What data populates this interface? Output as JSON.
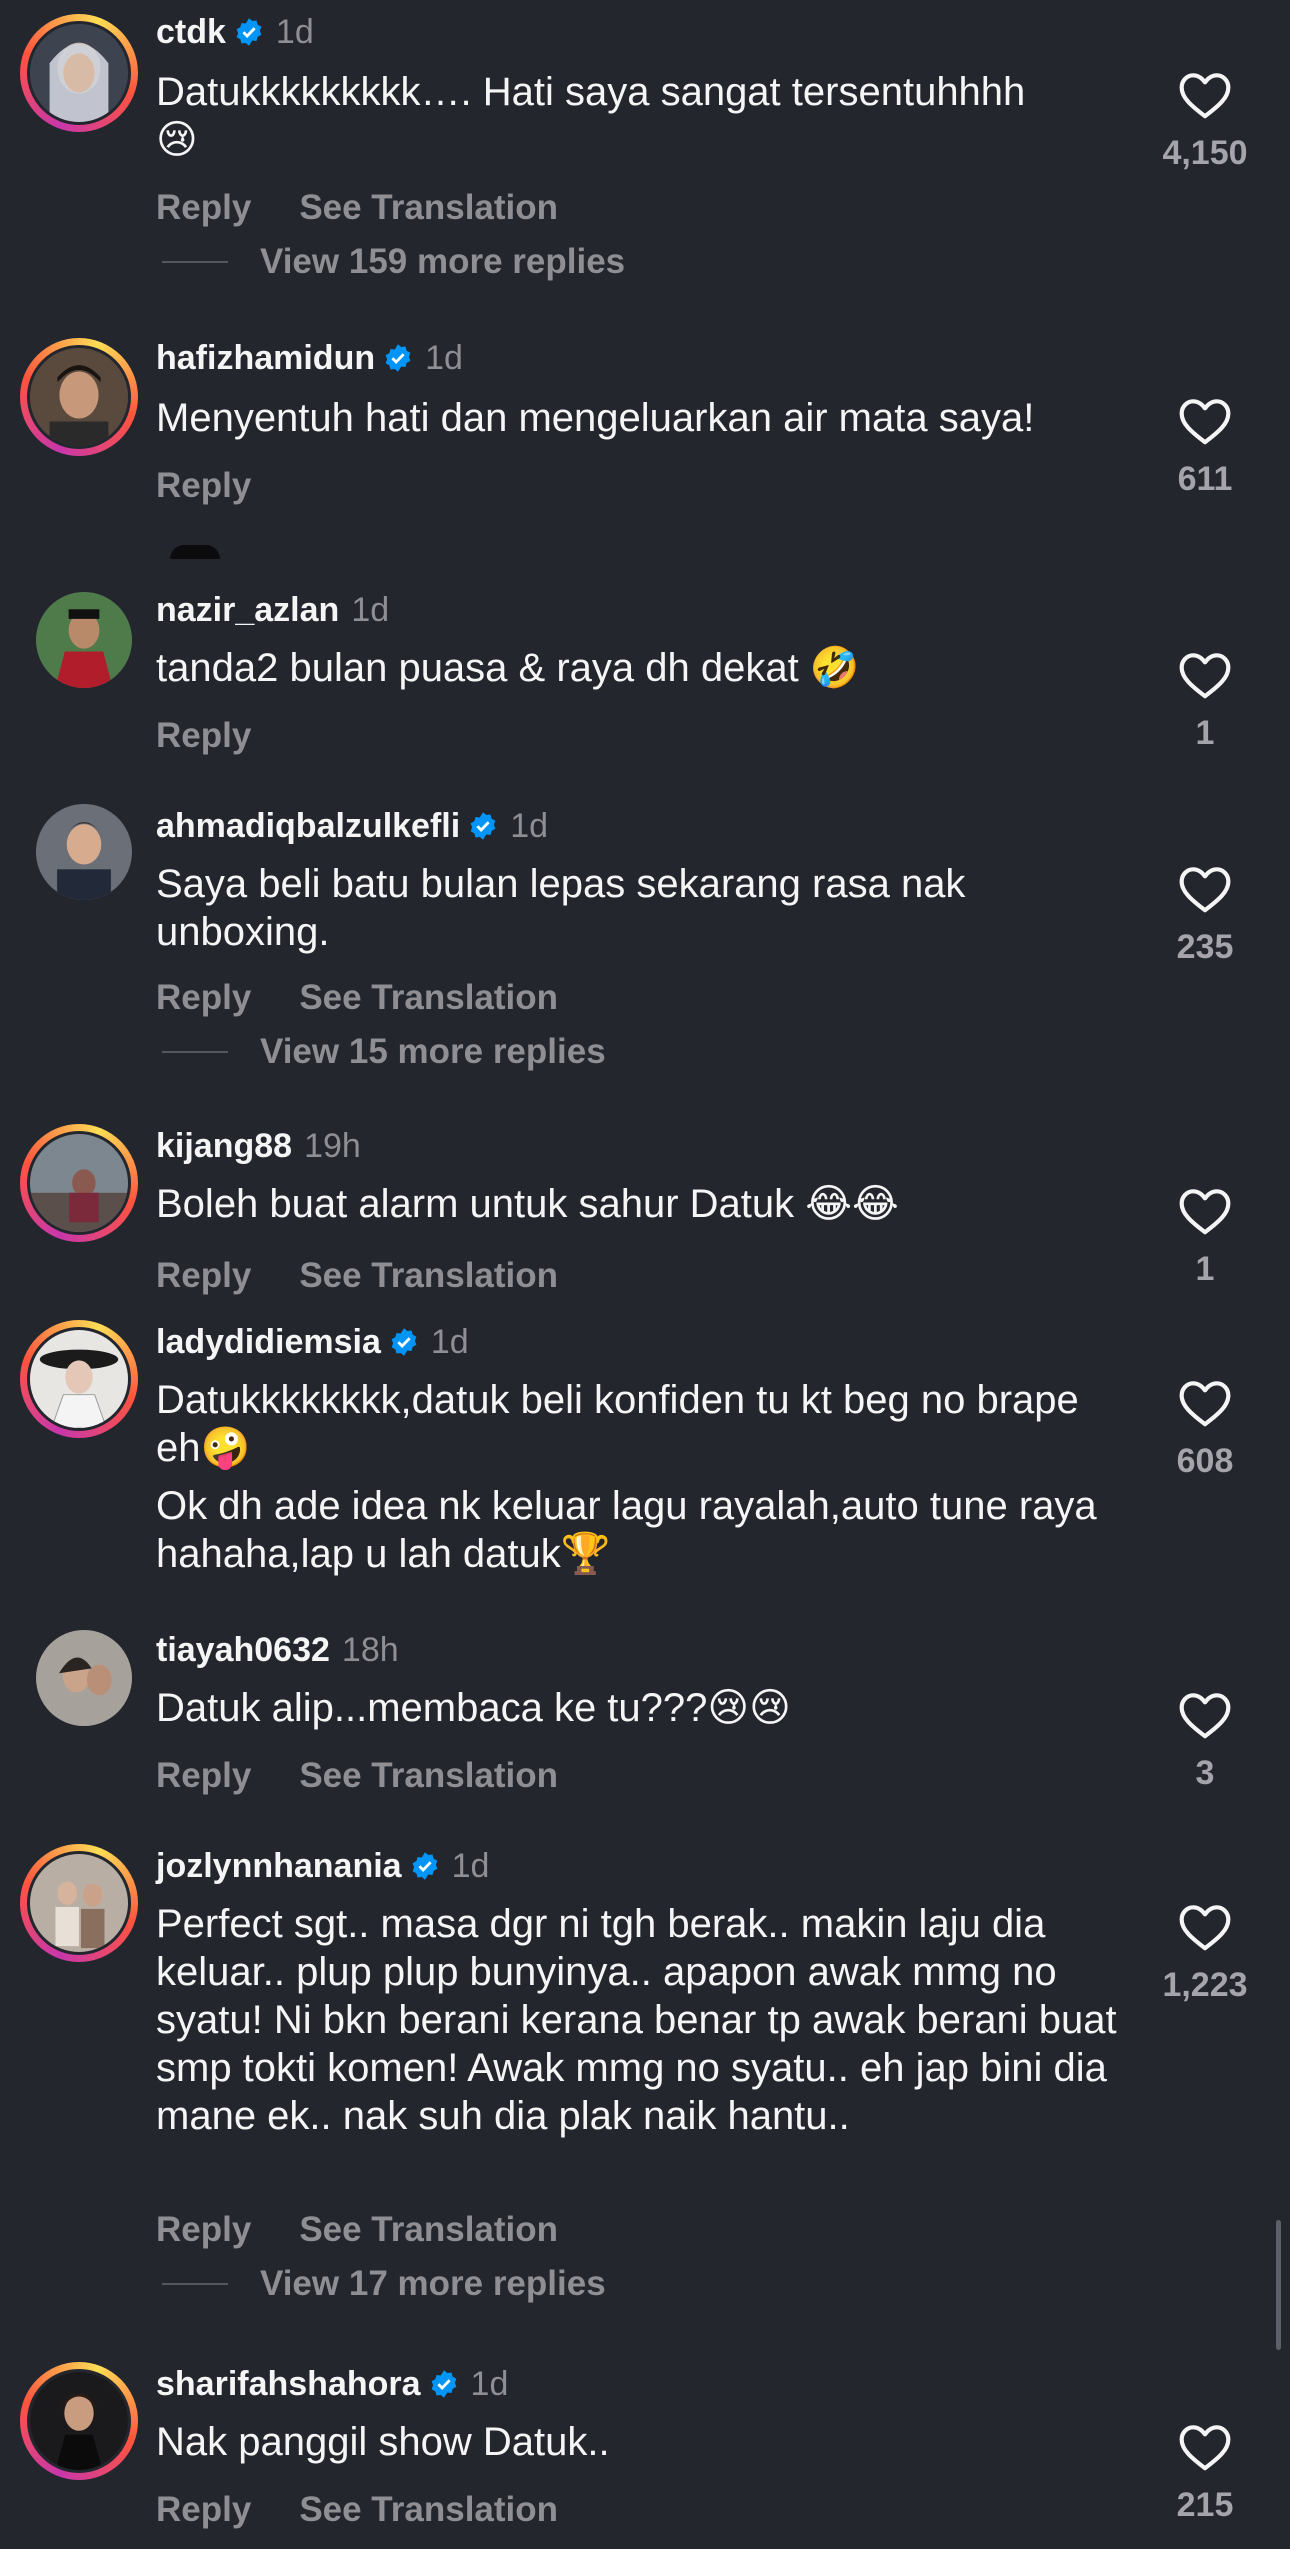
{
  "comments": [
    {
      "username": "ctdk",
      "verified": true,
      "time": "1d",
      "text": "Datukkkkkkkkk…. Hati saya sangat tersentuhhhh",
      "emoji": "😢",
      "reply": "Reply",
      "translation": "See Translation",
      "more": "View 159 more replies",
      "likes": "4,150",
      "ring": true
    },
    {
      "username": "hafizhamidun",
      "verified": true,
      "time": "1d",
      "text": "Menyentuh hati dan mengeluarkan air mata saya!",
      "emoji": "",
      "reply": "Reply",
      "translation": "",
      "more": "",
      "likes": "611",
      "ring": true
    },
    {
      "username": "nazir_azlan",
      "verified": false,
      "time": "1d",
      "text": "tanda2 bulan puasa & raya dh dekat",
      "emoji": "🤣",
      "reply": "Reply",
      "translation": "",
      "more": "",
      "likes": "1",
      "ring": false
    },
    {
      "username": "ahmadiqbalzulkefli",
      "verified": true,
      "time": "1d",
      "text": "Saya beli batu bulan lepas sekarang rasa nak unboxing.",
      "emoji": "",
      "reply": "Reply",
      "translation": "See Translation",
      "more": "View 15 more replies",
      "likes": "235",
      "ring": false
    },
    {
      "username": "kijang88",
      "verified": false,
      "time": "19h",
      "text": "Boleh buat alarm untuk sahur Datuk",
      "emoji": "😂😂",
      "reply": "Reply",
      "translation": "See Translation",
      "more": "",
      "likes": "1",
      "ring": true
    },
    {
      "username": "ladydidiemsia",
      "verified": true,
      "time": "1d",
      "text": "Datukkkkkkkk,datuk beli konfiden tu kt beg no brape eh",
      "emoji": "🤪",
      "text2": "Ok dh ade idea nk keluar lagu rayalah,auto tune raya hahaha,lap u lah datuk",
      "emoji2": "🏆",
      "reply": "",
      "translation": "",
      "more": "",
      "likes": "608",
      "ring": true
    },
    {
      "username": "tiayah0632",
      "verified": false,
      "time": "18h",
      "text": "Datuk alip...membaca ke tu???",
      "emoji": "😢😢",
      "reply": "Reply",
      "translation": "See Translation",
      "more": "",
      "likes": "3",
      "ring": false
    },
    {
      "username": "jozlynnhanania",
      "verified": true,
      "time": "1d",
      "text": "Perfect sgt.. masa dgr ni tgh berak.. makin laju dia keluar.. plup plup bunyinya.. apapon awak mmg no syatu! Ni bkn berani kerana benar tp awak berani buat smp tokti komen! Awak mmg no syatu.. eh jap bini dia mane ek.. nak suh dia plak naik hantu..",
      "emoji": "",
      "reply": "Reply",
      "translation": "See Translation",
      "more": "View 17 more replies",
      "likes": "1,223",
      "ring": true
    },
    {
      "username": "sharifahshahora",
      "verified": true,
      "time": "1d",
      "text": "Nak panggil show Datuk..",
      "emoji": "",
      "reply": "Reply",
      "translation": "See Translation",
      "more": "",
      "likes": "215",
      "ring": true
    }
  ],
  "colors": {
    "background": "#24262e",
    "verified": "#0095f6",
    "muted": "#8e8e93"
  },
  "icons": {
    "like": "heart-outline-icon",
    "verified": "verified-badge-icon"
  }
}
